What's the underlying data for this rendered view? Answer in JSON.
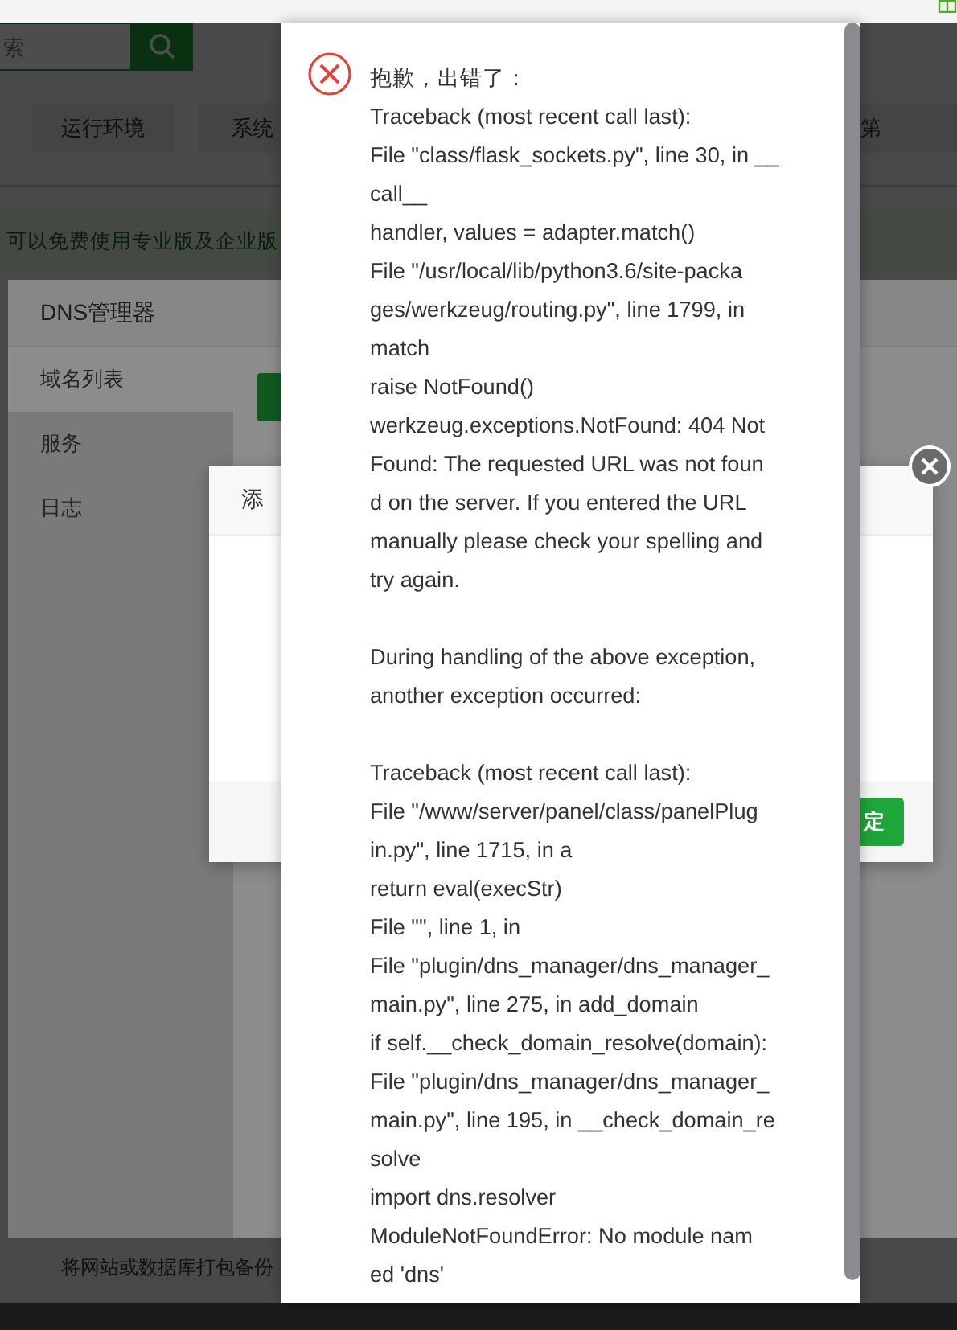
{
  "page": {
    "search": {
      "placeholder": "索"
    },
    "nav_tabs": [
      {
        "label": "运行环境"
      },
      {
        "label": "系统"
      },
      {
        "label": "第"
      }
    ],
    "banner": "可以免费使用专业版及企业版",
    "footer_text": "将网站或数据库打包备份"
  },
  "dns_manager": {
    "title": "DNS管理器",
    "sidebar": [
      {
        "label": "域名列表",
        "selected": true
      },
      {
        "label": "服务",
        "selected": false
      },
      {
        "label": "日志",
        "selected": false
      }
    ]
  },
  "add_dialog": {
    "title": "添",
    "confirm_button": "定"
  },
  "error_popup": {
    "title": "抱歉，出错了：",
    "paragraphs": [
      [
        "Traceback (most recent call last):",
        "File \"class/flask_sockets.py\", line 30, in __",
        "call__",
        "handler, values = adapter.match()",
        "File \"/usr/local/lib/python3.6/site-packa",
        "ges/werkzeug/routing.py\", line 1799, in",
        "match",
        "raise NotFound()",
        "werkzeug.exceptions.NotFound: 404 Not",
        "Found: The requested URL was not foun",
        "d on the server. If you entered the URL",
        "manually please check your spelling and",
        "try again."
      ],
      [
        "During handling of the above exception,",
        "another exception occurred:"
      ],
      [
        "Traceback (most recent call last):",
        "File \"/www/server/panel/class/panelPlug",
        "in.py\", line 1715, in a",
        "return eval(execStr)",
        "File \"\", line 1, in",
        "File \"plugin/dns_manager/dns_manager_",
        "main.py\", line 275, in add_domain",
        "if self.__check_domain_resolve(domain):",
        "File \"plugin/dns_manager/dns_manager_",
        "main.py\", line 195, in __check_domain_re",
        "solve",
        "import dns.resolver",
        "ModuleNotFoundError: No module nam",
        "ed 'dns'"
      ]
    ]
  }
}
